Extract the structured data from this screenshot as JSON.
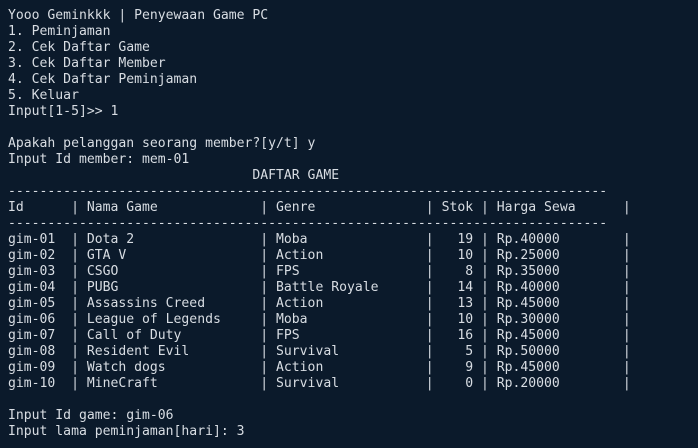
{
  "terminal": {
    "title_line": "Yooo Geminkkk | Penyewaan Game PC",
    "menu": [
      "1. Peminjaman",
      "2. Cek Daftar Game",
      "3. Cek Daftar Member",
      "4. Cek Daftar Peminjaman",
      "5. Keluar"
    ],
    "menu_prompt": "Input[1-5]>> 1",
    "member_question": "Apakah pelanggan seorang member?[y/t] y",
    "member_id_prompt": "Input Id member: mem-01",
    "table_title": "                               DAFTAR GAME",
    "table_rule": "----------------------------------------------------------------------------",
    "table_header": "Id      | Nama Game             | Genre              | Stok | Harga Sewa      |",
    "table_header_rule": "----------------------------------------------------------------------------",
    "rows": [
      "gim-01  | Dota 2                | Moba               |   19 | Rp.40000        |",
      "gim-02  | GTA V                 | Action             |   10 | Rp.25000        |",
      "gim-03  | CSGO                  | FPS                |    8 | Rp.35000        |",
      "gim-04  | PUBG                  | Battle Royale      |   14 | Rp.40000        |",
      "gim-05  | Assassins Creed       | Action             |   13 | Rp.45000        |",
      "gim-06  | League of Legends     | Moba               |   10 | Rp.30000        |",
      "gim-07  | Call of Duty          | FPS                |   16 | Rp.45000        |",
      "gim-08  | Resident Evil         | Survival           |    5 | Rp.50000        |",
      "gim-09  | Watch dogs            | Action             |    9 | Rp.45000        |",
      "gim-10  | MineCraft             | Survival           |    0 | Rp.20000        |"
    ],
    "game_id_prompt": "Input Id game: gim-06",
    "duration_prompt": "Input lama peminjaman[hari]: 3"
  }
}
